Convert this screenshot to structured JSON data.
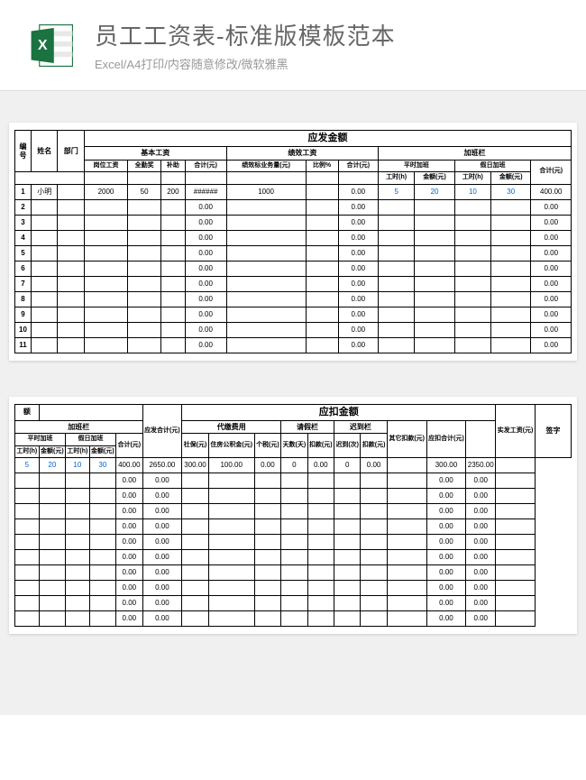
{
  "header": {
    "title": "员工工资表-标准版模板范本",
    "subtitle": "Excel/A4打印/内容随意修改/微软雅黑"
  },
  "table1": {
    "section_title": "应发金额",
    "head": {
      "col_id": "编号",
      "col_name": "姓名",
      "col_dept": "部门",
      "grp_basic": "基本工资",
      "grp_perf": "绩效工资",
      "grp_ot": "加班栏",
      "basic_post": "岗位工资",
      "basic_attend": "全勤奖",
      "basic_sub": "补助",
      "basic_sum": "合计(元)",
      "perf_std": "绩效标业务量(元)",
      "perf_pct": "比例%",
      "perf_sum": "合计(元)",
      "ot_normal": "平时加班",
      "ot_holiday": "假日加班",
      "ot_hours": "工时(h)",
      "ot_amt": "金额(元)",
      "ot_sum": "合计(元)"
    },
    "rows": [
      {
        "id": "1",
        "name": "小明",
        "dept": "",
        "post": "2000",
        "attend": "50",
        "sub": "200",
        "basic_sum": "######",
        "perf_std": "1000",
        "perf_pct": "",
        "perf_sum": "0.00",
        "ot_nh": "5",
        "ot_na": "20",
        "ot_hh": "10",
        "ot_ha": "30",
        "ot_sum": "400.00"
      },
      {
        "id": "2",
        "basic_sum": "0.00",
        "perf_sum": "0.00",
        "ot_sum": "0.00"
      },
      {
        "id": "3",
        "basic_sum": "0.00",
        "perf_sum": "0.00",
        "ot_sum": "0.00"
      },
      {
        "id": "4",
        "basic_sum": "0.00",
        "perf_sum": "0.00",
        "ot_sum": "0.00"
      },
      {
        "id": "5",
        "basic_sum": "0.00",
        "perf_sum": "0.00",
        "ot_sum": "0.00"
      },
      {
        "id": "6",
        "basic_sum": "0.00",
        "perf_sum": "0.00",
        "ot_sum": "0.00"
      },
      {
        "id": "7",
        "basic_sum": "0.00",
        "perf_sum": "0.00",
        "ot_sum": "0.00"
      },
      {
        "id": "8",
        "basic_sum": "0.00",
        "perf_sum": "0.00",
        "ot_sum": "0.00"
      },
      {
        "id": "9",
        "basic_sum": "0.00",
        "perf_sum": "0.00",
        "ot_sum": "0.00"
      },
      {
        "id": "10",
        "basic_sum": "0.00",
        "perf_sum": "0.00",
        "ot_sum": "0.00"
      },
      {
        "id": "11",
        "basic_sum": "0.00",
        "perf_sum": "0.00",
        "ot_sum": "0.00"
      }
    ]
  },
  "table2": {
    "section_title_deduct": "应扣金额",
    "head": {
      "top_e": "额",
      "grp_ot": "加班栏",
      "ot_normal": "平时加班",
      "ot_holiday": "假日加班",
      "ot_hours": "工时(h)",
      "ot_amt": "金额(元)",
      "ot_sum": "合计(元)",
      "payable_sum": "应发合计(元)",
      "grp_pay": "代缴费用",
      "pay_social": "社保(元)",
      "pay_fund": "住房公积金(元)",
      "pay_tax": "个税(元)",
      "grp_leave": "请假栏",
      "leave_days": "天数(天)",
      "leave_amt": "扣款(元)",
      "grp_late": "迟到栏",
      "late_times": "迟到(次)",
      "late_amt": "扣款(元)",
      "other_deduct": "其它扣款(元)",
      "deduct_sum": "应扣合计(元)",
      "net_pay": "实发工资(元)",
      "sign": "签字"
    },
    "rows": [
      {
        "ot_nh": "5",
        "ot_na": "20",
        "ot_hh": "10",
        "ot_ha": "30",
        "ot_sum": "400.00",
        "payable": "2650.00",
        "social": "300.00",
        "fund": "100.00",
        "tax": "0.00",
        "leave_d": "0",
        "leave_a": "0.00",
        "late_t": "0",
        "late_a": "0.00",
        "other": "",
        "deduct": "300.00",
        "net": "2350.00"
      },
      {
        "ot_sum": "0.00",
        "payable": "0.00",
        "deduct": "0.00",
        "net": "0.00"
      },
      {
        "ot_sum": "0.00",
        "payable": "0.00",
        "deduct": "0.00",
        "net": "0.00"
      },
      {
        "ot_sum": "0.00",
        "payable": "0.00",
        "deduct": "0.00",
        "net": "0.00"
      },
      {
        "ot_sum": "0.00",
        "payable": "0.00",
        "deduct": "0.00",
        "net": "0.00"
      },
      {
        "ot_sum": "0.00",
        "payable": "0.00",
        "deduct": "0.00",
        "net": "0.00"
      },
      {
        "ot_sum": "0.00",
        "payable": "0.00",
        "deduct": "0.00",
        "net": "0.00"
      },
      {
        "ot_sum": "0.00",
        "payable": "0.00",
        "deduct": "0.00",
        "net": "0.00"
      },
      {
        "ot_sum": "0.00",
        "payable": "0.00",
        "deduct": "0.00",
        "net": "0.00"
      },
      {
        "ot_sum": "0.00",
        "payable": "0.00",
        "deduct": "0.00",
        "net": "0.00"
      },
      {
        "ot_sum": "0.00",
        "payable": "0.00",
        "deduct": "0.00",
        "net": "0.00"
      }
    ]
  }
}
